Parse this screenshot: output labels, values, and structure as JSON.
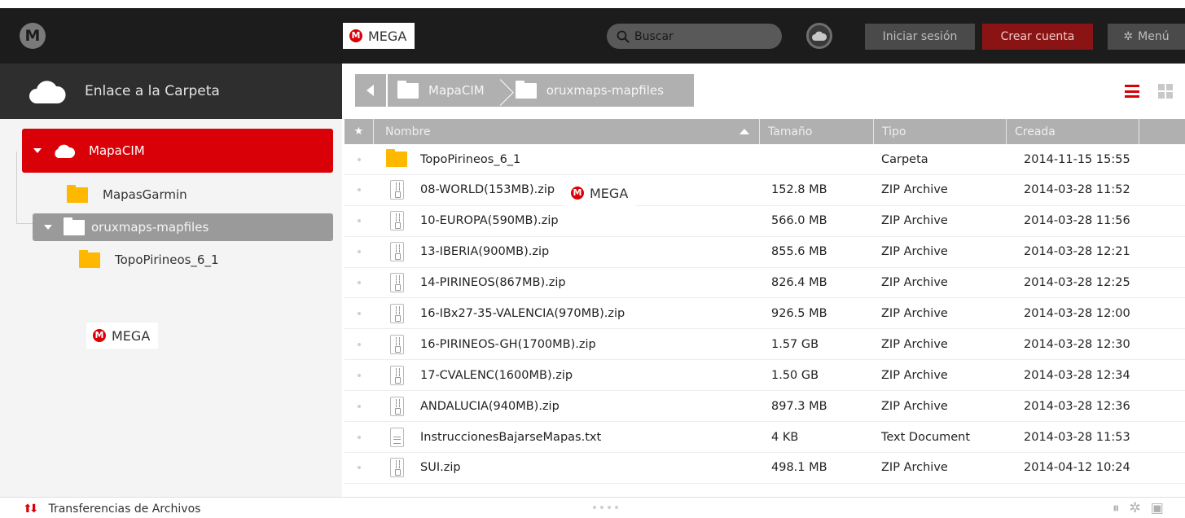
{
  "topbar": {
    "logo_letter": "M",
    "brand_badge": "MEGA",
    "search_placeholder": "Buscar",
    "login_label": "Iniciar sesión",
    "create_account_label": "Crear cuenta",
    "menu_label": "Menú"
  },
  "sidebar": {
    "header_title": "Enlace a la Carpeta",
    "tree": {
      "root": "MapaCIM",
      "child_1": "MapasGarmin",
      "child_2": "oruxmaps-mapfiles",
      "grandchild": "TopoPirineos_6_1"
    },
    "watermark": "MEGA"
  },
  "breadcrumb": [
    "MapaCIM",
    "oruxmaps-mapfiles"
  ],
  "table": {
    "columns": [
      "Nombre",
      "Tamaño",
      "Tipo",
      "Creada"
    ],
    "rows": [
      {
        "name": "TopoPirineos_6_1",
        "size": "",
        "type": "Carpeta",
        "created": "2014-11-15 15:55",
        "icon": "folder"
      },
      {
        "name": "08-WORLD(153MB).zip",
        "size": "152.8 MB",
        "type": "ZIP Archive",
        "created": "2014-03-28 11:52",
        "icon": "zip"
      },
      {
        "name": "10-EUROPA(590MB).zip",
        "size": "566.0 MB",
        "type": "ZIP Archive",
        "created": "2014-03-28 11:56",
        "icon": "zip"
      },
      {
        "name": "13-IBERIA(900MB).zip",
        "size": "855.6 MB",
        "type": "ZIP Archive",
        "created": "2014-03-28 12:21",
        "icon": "zip"
      },
      {
        "name": "14-PIRINEOS(867MB).zip",
        "size": "826.4 MB",
        "type": "ZIP Archive",
        "created": "2014-03-28 12:25",
        "icon": "zip"
      },
      {
        "name": "16-IBx27-35-VALENCIA(970MB).zip",
        "size": "926.5 MB",
        "type": "ZIP Archive",
        "created": "2014-03-28 12:00",
        "icon": "zip"
      },
      {
        "name": "16-PIRINEOS-GH(1700MB).zip",
        "size": "1.57 GB",
        "type": "ZIP Archive",
        "created": "2014-03-28 12:30",
        "icon": "zip"
      },
      {
        "name": "17-CVALENC(1600MB).zip",
        "size": "1.50 GB",
        "type": "ZIP Archive",
        "created": "2014-03-28 12:34",
        "icon": "zip"
      },
      {
        "name": "ANDALUCIA(940MB).zip",
        "size": "897.3 MB",
        "type": "ZIP Archive",
        "created": "2014-03-28 12:36",
        "icon": "zip"
      },
      {
        "name": "InstruccionesBajarseMapas.txt",
        "size": "4 KB",
        "type": "Text Document",
        "created": "2014-03-28 11:53",
        "icon": "text"
      },
      {
        "name": "SUI.zip",
        "size": "498.1 MB",
        "type": "ZIP Archive",
        "created": "2014-04-12 10:24",
        "icon": "zip"
      }
    ],
    "overlay_badge": "MEGA"
  },
  "footer": {
    "transfers_label": "Transferencias de Archivos"
  },
  "colors": {
    "brand_red": "#d90007",
    "topbar_bg": "#1c1c1c",
    "folder_yellow": "#ffb800"
  }
}
